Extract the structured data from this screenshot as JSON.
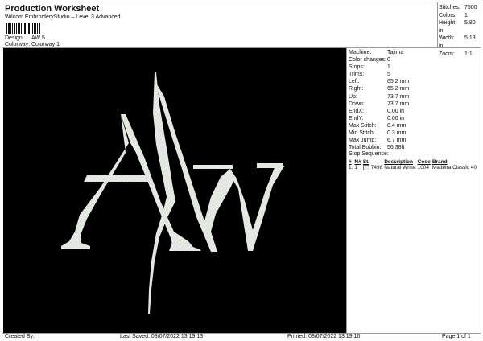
{
  "header": {
    "title": "Production Worksheet",
    "subtitle": "Wilcom EmbroideryStudio – Level 3 Advanced",
    "barcode": "barcode-icon"
  },
  "meta": {
    "design_label": "Design:",
    "design_value": "AW 5",
    "colorway_label": "Colorway:",
    "colorway_value": "Colorway 1"
  },
  "stats": [
    {
      "label": "Stitches:",
      "value": "7500"
    },
    {
      "label": "Colors:",
      "value": "1"
    },
    {
      "label": "Height:",
      "value": "5.80 in"
    },
    {
      "label": "Width:",
      "value": "5.13 in"
    },
    {
      "label": "Zoom:",
      "value": "1:1"
    }
  ],
  "design": {
    "background": "#000000",
    "thread_color": "#e8ece6",
    "glyph_a": "A",
    "glyph_w": "W"
  },
  "info": [
    {
      "label": "Machine:",
      "value": "Tajima"
    },
    {
      "label": "Color changes:",
      "value": "0"
    },
    {
      "label": "Stops:",
      "value": "1"
    },
    {
      "label": "Trims:",
      "value": "5"
    },
    {
      "label": "Left:",
      "value": "65.2 mm"
    },
    {
      "label": "Right:",
      "value": "65.2 mm"
    },
    {
      "label": "Up:",
      "value": "73.7 mm"
    },
    {
      "label": "Down:",
      "value": "73.7 mm"
    },
    {
      "label": "EndX:",
      "value": "0.00 in"
    },
    {
      "label": "EndY:",
      "value": "0.00 in"
    },
    {
      "label": "Max Stitch:",
      "value": "8.4 mm"
    },
    {
      "label": "Min Stitch:",
      "value": "0.3 mm"
    },
    {
      "label": "Max Jump:",
      "value": "6.7 mm"
    },
    {
      "label": "Total Bobbin:",
      "value": "56.38ft"
    }
  ],
  "stop_sequence": {
    "title": "Stop Sequence:",
    "headers": [
      "#",
      "N#",
      "St.",
      "Description",
      "Code",
      "Brand"
    ],
    "rows": [
      {
        "num": "1.",
        "n": "1",
        "st": "7498",
        "description": "Natural White",
        "code": "1004",
        "brand": "Madeira Classic 40"
      }
    ]
  },
  "footer": {
    "created_by": "Created By:",
    "last_saved": "Last Saved: 08/07/2022 13:19:13",
    "printed": "Printed: 08/07/2022 13:19:16",
    "page": "Page 1 of 1"
  }
}
